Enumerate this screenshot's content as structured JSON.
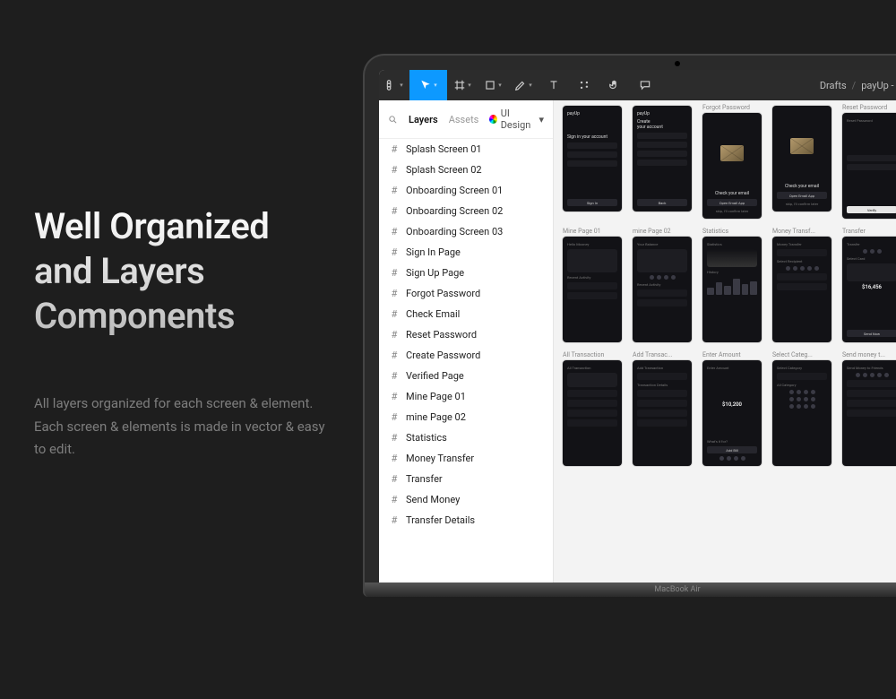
{
  "marketing": {
    "headline_l1": "Well Organized",
    "headline_l2": "and Layers",
    "headline_l3": "Components",
    "body": "All layers organized for each screen & element. Each screen & elements is made in vector & easy to edit."
  },
  "device": {
    "model": "MacBook Air"
  },
  "toolbar": {
    "tools": [
      "menu",
      "move",
      "frame",
      "rectangle",
      "pen",
      "text",
      "resources",
      "hand",
      "comment"
    ]
  },
  "breadcrumb": {
    "root": "Drafts",
    "file": "payUp - Finance Mobile App"
  },
  "panel": {
    "tabs": {
      "layers": "Layers",
      "assets": "Assets"
    },
    "page_label": "UI Design",
    "layers": [
      "Splash Screen 01",
      "Splash Screen 02",
      "Onboarding Screen 01",
      "Onboarding Screen 02",
      "Onboarding Screen 03",
      "Sign In Page",
      "Sign Up Page",
      "Forgot Password",
      "Check Email",
      "Reset Password",
      "Create Password",
      "Verified Page",
      "Mine Page 01",
      "mine Page 02",
      "Statistics",
      "Money Transfer",
      "Transfer",
      "Send Money",
      "Transfer Details"
    ]
  },
  "canvas": {
    "row1_labels": [
      "",
      "",
      "Forgot Password",
      "",
      "Reset Password"
    ],
    "row1_brand": "payUp",
    "signin_heading": "Sign in your account",
    "signup_heading_l1": "Create",
    "signup_heading_l2": "your account",
    "check_email": "Check your email",
    "open_email": "Open Email App",
    "verify": "Verify",
    "back": "Back",
    "row2_labels": [
      "Mine Page 01",
      "mine Page 02",
      "Statistics",
      "Money Transf...",
      "Transfer"
    ],
    "row3_labels": [
      "All Transaction",
      "Add Transac...",
      "Enter Amount",
      "Select Categ...",
      "Send money t..."
    ],
    "amount": "$10,200"
  }
}
